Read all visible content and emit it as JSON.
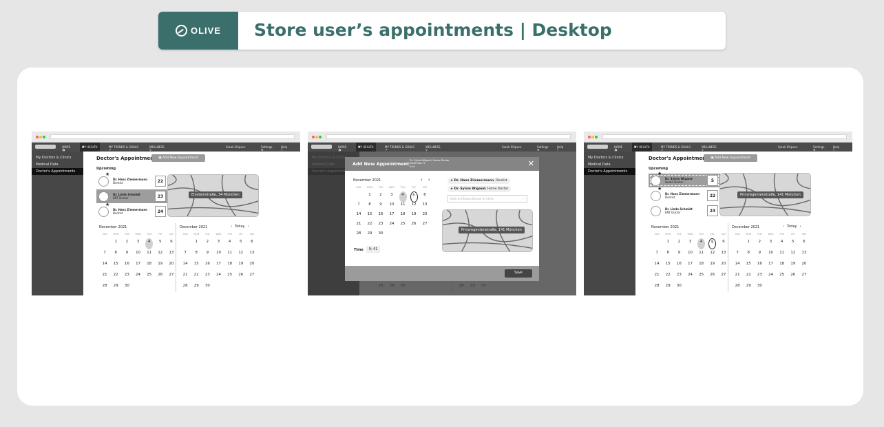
{
  "header": {
    "logo_text": "OLIVE",
    "title": "Store user’s appointments | Desktop",
    "brand_color": "#3b6f6b"
  },
  "nav": {
    "home": "HOME",
    "my_health": "MY HEALTH",
    "trends": "MY TRENDS & GOALS",
    "wellness": "WELLNESS",
    "user": "Sarah Ellipsen",
    "settings": "Settings",
    "help": "Help"
  },
  "sidebar": {
    "items": [
      "My Doctors & Clinics",
      "Medical Data",
      "Doctor's Appointments"
    ]
  },
  "page": {
    "title": "Doctor's Appointments",
    "add_button": "Add New Appointment",
    "upcoming": "Upcoming",
    "today": "Today"
  },
  "screen1": {
    "appointments": [
      {
        "name": "Dr. Hans Zimmermann",
        "specialty": "Dentist",
        "date": "22",
        "starred": true
      },
      {
        "name": "Dr. Linda Schmidt",
        "specialty": "ENT Doctor",
        "date": "23",
        "starred": false
      },
      {
        "name": "Dr. Hans Zimmermann",
        "specialty": "Dentist",
        "date": "24",
        "starred": true
      }
    ],
    "map_address": "Einsteinstraße, 34 München"
  },
  "screen2": {
    "modal_title": "Add New Appointment",
    "modal_doctor": "Dr. Sylvia Wigand, Home Doctor",
    "modal_date": "November 5",
    "modal_time": "9:41",
    "doctors": [
      {
        "name": "Dr. Hans Zimmermann",
        "specialty": "Dentist"
      },
      {
        "name": "Dr. Sylvia Wigand",
        "specialty": "Home Doctor"
      }
    ],
    "select_placeholder": "Click to Choose Doctor or Clinic",
    "map_address": "Prinzregentenstraße, 141 München",
    "time_label": "Time",
    "time_value": "9: 41",
    "save": "Save"
  },
  "screen3": {
    "appointments": [
      {
        "name": "Dr. Sylvia Wigand",
        "specialty": "Home Doctor",
        "date": "5",
        "starred": true
      },
      {
        "name": "Dr. Hans Zimmermann",
        "specialty": "Dentist",
        "date": "22",
        "starred": true
      },
      {
        "name": "Dr. Linda Schmidt",
        "specialty": "ENT Doctor",
        "date": "23",
        "starred": false
      }
    ],
    "map_address": "Prinzregentenstraße, 141 München"
  },
  "calendar": {
    "weekdays": [
      "SUN",
      "MON",
      "TUE",
      "WED",
      "THU",
      "FRI",
      "SAT"
    ],
    "months": [
      {
        "title": "November 2021",
        "weeks": [
          [
            "",
            "1",
            "2",
            "3",
            "4",
            "5",
            "6"
          ],
          [
            "7",
            "8",
            "9",
            "10",
            "11",
            "12",
            "13"
          ],
          [
            "14",
            "15",
            "16",
            "17",
            "18",
            "19",
            "20"
          ],
          [
            "21",
            "22",
            "23",
            "24",
            "25",
            "26",
            "27"
          ],
          [
            "28",
            "29",
            "30",
            "",
            "",
            "",
            ""
          ]
        ]
      },
      {
        "title": "December 2021",
        "weeks": [
          [
            "",
            "1",
            "2",
            "3",
            "4",
            "5",
            "6"
          ],
          [
            "7",
            "8",
            "9",
            "10",
            "11",
            "12",
            "13"
          ],
          [
            "14",
            "15",
            "16",
            "17",
            "18",
            "19",
            "20"
          ],
          [
            "21",
            "22",
            "23",
            "24",
            "25",
            "26",
            "27"
          ],
          [
            "28",
            "29",
            "30",
            "",
            "",
            "",
            ""
          ]
        ]
      }
    ]
  }
}
